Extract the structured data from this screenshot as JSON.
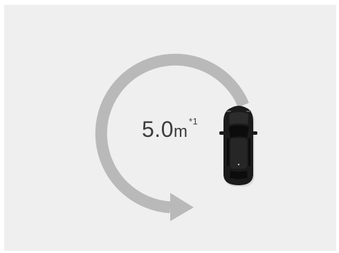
{
  "turning_radius": {
    "value": "5.0",
    "unit": "m",
    "footnote_marker": "*1"
  },
  "colors": {
    "background": "#efefef",
    "arrow": "#b9b9b9",
    "car_body": "#1b1b1b",
    "text": "#3c3c3c"
  },
  "icons": [
    "turning-arc-arrow",
    "car-top-view-icon"
  ]
}
